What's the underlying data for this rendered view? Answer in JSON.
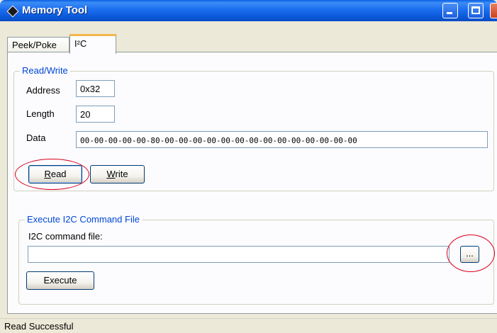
{
  "window": {
    "title": "Memory Tool",
    "accent_color": "#0a58d8",
    "icons": [
      "app-icon",
      "minimize-icon",
      "maximize-icon",
      "close-icon"
    ]
  },
  "tabs": [
    {
      "label": "Peek/Poke",
      "active": false
    },
    {
      "label": "I²C",
      "active": true
    }
  ],
  "read_write": {
    "group_title": "Read/Write",
    "address_label": "Address",
    "address_value": "0x32",
    "length_label": "Length",
    "length_value": "20",
    "data_label": "Data",
    "data_value": "00-00-00-00-00-80-00-00-00-00-00-00-00-00-00-00-00-00-00-00",
    "read_button": {
      "label_first": "R",
      "label_rest": "ead"
    },
    "write_button": {
      "label_first": "W",
      "label_rest": "rite"
    }
  },
  "execute": {
    "group_title": "Execute I2C Command File",
    "file_label": "I2C command file:",
    "file_value": "",
    "browse_label": "...",
    "execute_label": "Execute"
  },
  "annotation_color": "#d9001b",
  "status": {
    "text": "Read Successful"
  }
}
